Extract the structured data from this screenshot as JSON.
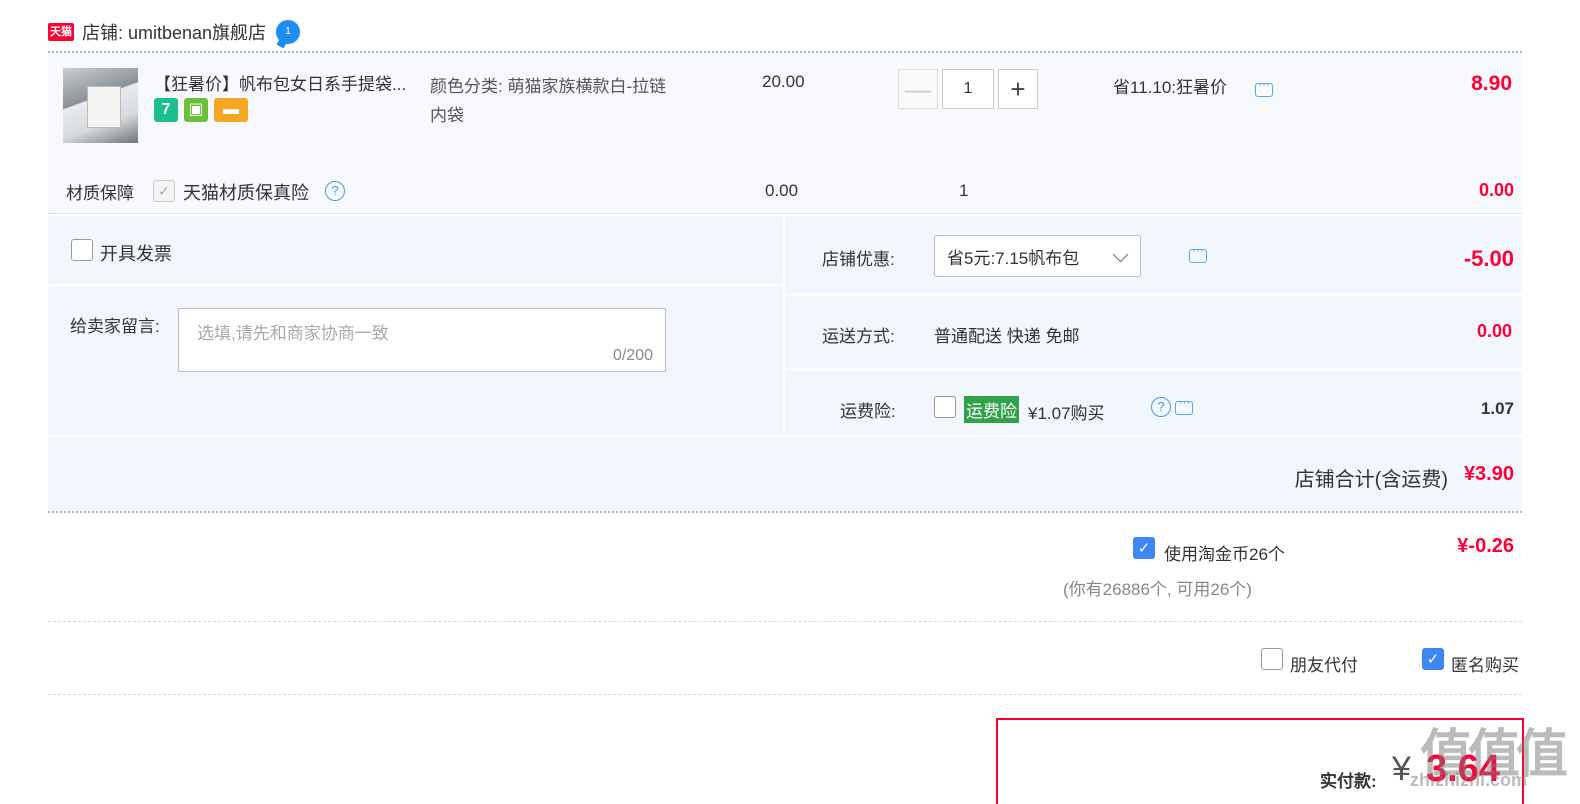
{
  "shop": {
    "logo_text": "天猫",
    "label": "店铺: umitbenan旗舰店",
    "chat_badge": "1"
  },
  "item": {
    "title": "【狂暑价】帆布包女日系手提袋...",
    "badges": {
      "seven": "7"
    },
    "sku_label": "颜色分类: 萌猫家族横款白-拉链",
    "sku_label_2": "内袋",
    "unit_price": "20.00",
    "quantity": "1",
    "decrement": "—",
    "increment": "+",
    "promo": "省11.10:狂暑价",
    "subtotal": "8.90"
  },
  "service": {
    "label": "材质保障",
    "name": "天猫材质保真险",
    "price": "0.00",
    "quantity": "1",
    "subtotal": "0.00"
  },
  "options": {
    "invoice_label": "开具发票",
    "message_label": "给卖家留言:",
    "message_placeholder": "选填,请先和商家协商一致",
    "message_count": "0/200",
    "coupon_label": "店铺优惠:",
    "coupon_value": "省5元:7.15帆布包",
    "coupon_amount": "-5.00",
    "shipping_label": "运送方式:",
    "shipping_value": "普通配送 快递 免邮",
    "shipping_amount": "0.00",
    "insurance_label": "运费险:",
    "insurance_tag": "运费险",
    "insurance_price": "¥1.07购买",
    "insurance_amount": "1.07"
  },
  "total": {
    "label": "店铺合计(含运费)",
    "value": "¥3.90"
  },
  "coins": {
    "label": "使用淘金币26个",
    "note": "(你有26886个, 可用26个)",
    "amount": "¥-0.26"
  },
  "payment_options": {
    "friend_pay": "朋友代付",
    "anonymous": "匿名购买"
  },
  "pay": {
    "label": "实付款:",
    "currency": "¥",
    "amount": "3.64"
  },
  "watermark": {
    "big": "值值值",
    "small": "zhizhizhi.com"
  }
}
